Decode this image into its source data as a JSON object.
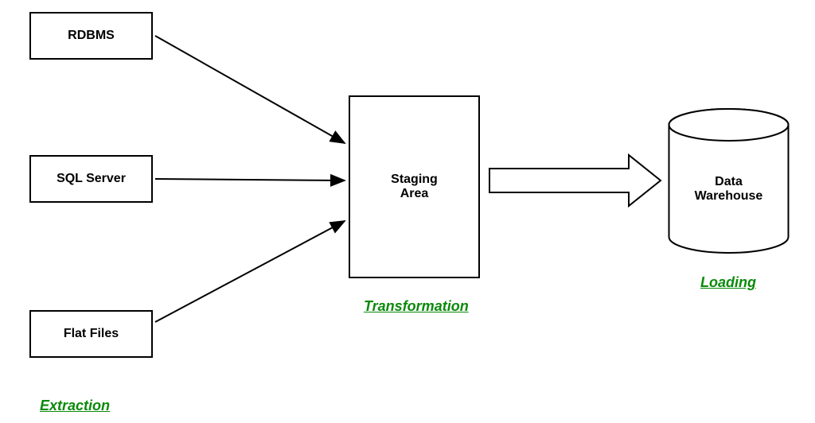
{
  "sources": {
    "rdbms": "RDBMS",
    "sql_server": "SQL Server",
    "flat_files": "Flat Files"
  },
  "staging": {
    "label_line1": "Staging",
    "label_line2": "Area"
  },
  "warehouse": {
    "label_line1": "Data",
    "label_line2": "Warehouse"
  },
  "stages": {
    "extraction": "Extraction",
    "transformation": "Transformation",
    "loading": "Loading"
  }
}
